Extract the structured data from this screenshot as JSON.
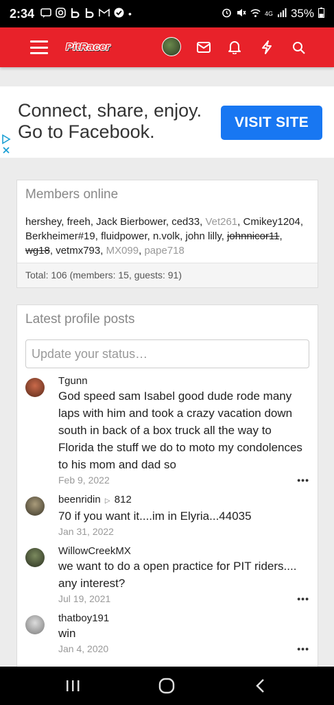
{
  "status_bar": {
    "time": "2:34",
    "network": "4G",
    "battery": "35%"
  },
  "app_bar": {
    "logo_text": "PitRacer"
  },
  "ad": {
    "headline_line1": "Connect, share, enjoy.",
    "headline_line2": "Go to Facebook.",
    "cta": "VISIT SITE"
  },
  "members_online": {
    "title": "Members online",
    "members": [
      {
        "name": "hershey",
        "style": "normal"
      },
      {
        "name": "freeh",
        "style": "normal"
      },
      {
        "name": "Jack Bierbower",
        "style": "normal"
      },
      {
        "name": "ced33",
        "style": "normal"
      },
      {
        "name": "Vet261",
        "style": "muted"
      },
      {
        "name": "Cmikey1204",
        "style": "normal"
      },
      {
        "name": "Berkheimer#19",
        "style": "normal"
      },
      {
        "name": "fluidpower",
        "style": "normal"
      },
      {
        "name": "n.volk",
        "style": "normal"
      },
      {
        "name": "john lilly",
        "style": "normal"
      },
      {
        "name": "johnnicor11",
        "style": "strike"
      },
      {
        "name": "wg18",
        "style": "strike"
      },
      {
        "name": "vetmx793",
        "style": "normal"
      },
      {
        "name": "MX099",
        "style": "muted"
      },
      {
        "name": "pape718",
        "style": "muted"
      }
    ],
    "total": "Total: 106 (members: 15, guests: 91)"
  },
  "profile_posts": {
    "title": "Latest profile posts",
    "placeholder": "Update your status…",
    "posts": [
      {
        "author": "Tgunn",
        "recipient": "",
        "text": "God speed sam Isabel good dude rode many laps with him and took a crazy vacation down south in back of a box truck all the way to Florida the stuff we do to moto my condolences to his mom and dad so",
        "date": "Feb 9, 2022"
      },
      {
        "author": "beenridin",
        "recipient": "812",
        "text": "70 if you want it....im in Elyria...44035",
        "date": "Jan 31, 2022"
      },
      {
        "author": "WillowCreekMX",
        "recipient": "",
        "text": "we want to do a open practice for PIT riders.... any interest?",
        "date": "Jul 19, 2021"
      },
      {
        "author": "thatboy191",
        "recipient": "",
        "text": "win",
        "date": "Jan 4, 2020"
      }
    ],
    "more_label": "•••"
  },
  "colors": {
    "brand_red": "#e8222a",
    "facebook_blue": "#1877f2"
  }
}
